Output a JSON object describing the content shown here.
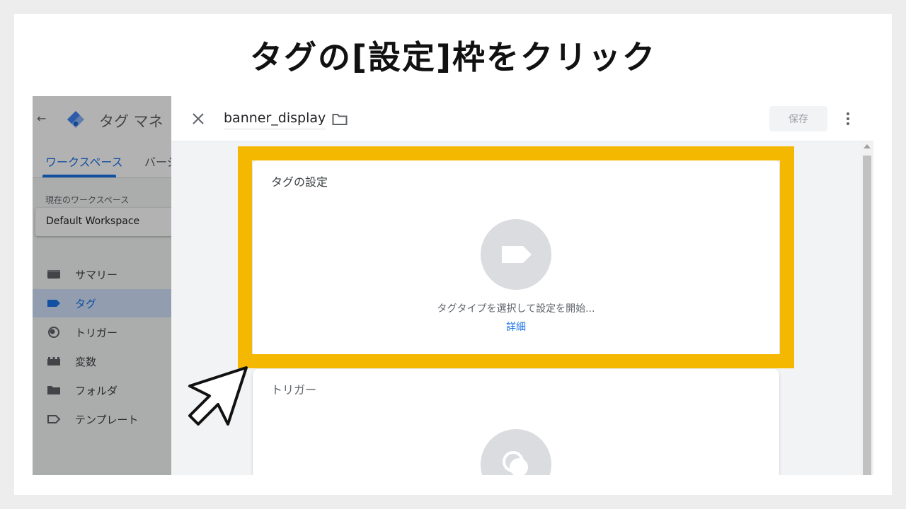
{
  "slide": {
    "title": "タグの[設定]枠をクリック"
  },
  "sidebar": {
    "back_icon": "arrow-back-icon",
    "app_title": "タグ マネ",
    "tabs": [
      {
        "label": "ワークスペース",
        "active": true
      },
      {
        "label": "バージ",
        "active": false
      }
    ],
    "workspace_label": "現在のワークスペース",
    "workspace_name": "Default Workspace",
    "items": [
      {
        "label": "サマリー",
        "icon": "summary-icon",
        "active": false
      },
      {
        "label": "タグ",
        "icon": "tag-icon",
        "active": true
      },
      {
        "label": "トリガー",
        "icon": "trigger-icon",
        "active": false
      },
      {
        "label": "変数",
        "icon": "variables-icon",
        "active": false
      },
      {
        "label": "フォルダ",
        "icon": "folder-icon",
        "active": false
      },
      {
        "label": "テンプレート",
        "icon": "template-icon",
        "active": false
      }
    ]
  },
  "editor": {
    "tag_name": "banner_display",
    "save_label": "保存",
    "tag_config": {
      "title": "タグの設定",
      "hint": "タグタイプを選択して設定を開始...",
      "learn_more": "詳細"
    },
    "trigger": {
      "title": "トリガー"
    }
  },
  "colors": {
    "highlight": "#f5b800",
    "accent": "#1a73e8",
    "active_nav_bg": "#d2e3fc"
  }
}
